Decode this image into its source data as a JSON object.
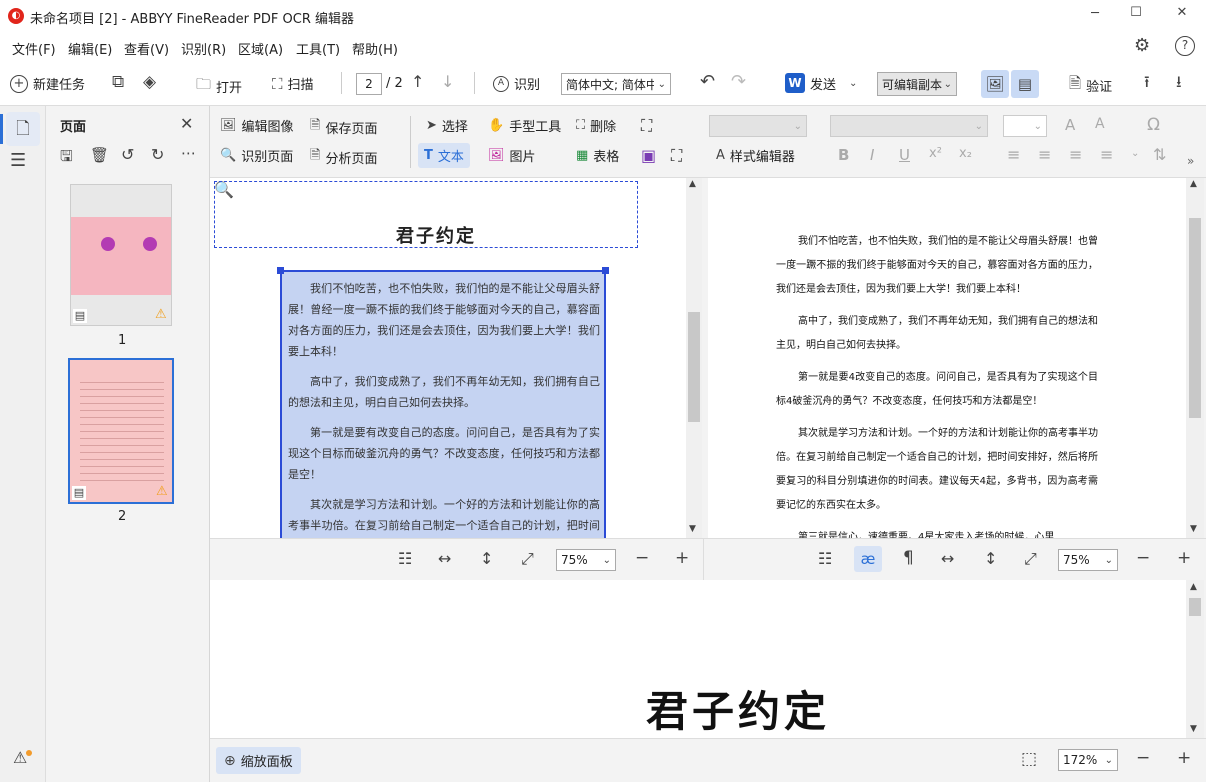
{
  "window": {
    "title": "未命名项目 [2] - ABBYY FineReader PDF OCR 编辑器",
    "minimize": "─",
    "maximize": "☐",
    "close": "✕"
  },
  "menu": [
    "文件(F)",
    "编辑(E)",
    "查看(V)",
    "识别(R)",
    "区域(A)",
    "工具(T)",
    "帮助(H)"
  ],
  "toolbar": {
    "new_task": "新建任务",
    "open": "打开",
    "scan": "扫描",
    "page_num": "2",
    "page_total": "/ 2",
    "recognize": "识别",
    "language": "简体中文; 简体中",
    "send": "发送",
    "edit_mode": "可编辑副本",
    "verify": "验证"
  },
  "pages_panel": {
    "title": "页面",
    "thumbs": [
      {
        "label": "1"
      },
      {
        "label": "2"
      }
    ]
  },
  "image_tools": {
    "edit_image": "编辑图像",
    "save_page": "保存页面",
    "recognize_page": "识别页面",
    "analyze_page": "分析页面",
    "select": "选择",
    "hand": "手型工具",
    "delete": "删除",
    "text": "文本",
    "picture": "图片",
    "table": "表格"
  },
  "text_tools": {
    "style_editor": "样式编辑器"
  },
  "source_doc": {
    "title": "君子约定",
    "paragraphs": [
      "我们不怕吃苦，也不怕失败，我们怕的是不能让父母眉头舒展！曾经一度一蹶不振的我们终于能够面对今天的自己，慕容面对各方面的压力，我们还是会去顶住，因为我们要上大学！我们要上本科！",
      "高中了，我们变成熟了，我们不再年幼无知，我们拥有自己的想法和主见，明白自己如何去抉择。",
      "第一就是要有改变自己的态度。问问自己，是否具有为了实现这个目标而破釜沉舟的勇气？不改变态度，任何技巧和方法都是空！",
      "其次就是学习方法和计划。一个好的方法和计划能让你的高考事半功倍。在复习前给自己制定一个适合自己的计划，把时间安排好，然后将所要复习的科目分别填进你的时间表。建议每天早起，多背书，因为高考需要记忆的东西实在太多。"
    ]
  },
  "ocr_text": {
    "paragraphs": [
      "我们不怕吃苦，也不怕失败，我们怕的是不能让父母眉头舒展！也曾一度一蹶不振的我们终于能够面对今天的自己，慕容面对各方面的压力，我们还是会去顶住，因为我们要上大学！我们要上本科！",
      "高中了，我们变成熟了，我们不再年幼无知，我们拥有自己的想法和主见，明白自己如何去抉择。",
      "第一就是要4改变自己的态度。问问自己，是否具有为了实现这个目标4破釜沉舟的勇气？不改变态度，任何技巧和方法都是空！",
      "其次就是学习方法和计划。一个好的方法和计划能让你的高考事半功倍。在复习前给自己制定一个适合自己的计划，把时间安排好，然后将所要复习的科目分别填进你的时间表。建议每天4起，多背书，因为高考需要记忆的东西实在太多。",
      "第三就是信心，速德重要。4星大家走入考场的时候，心里"
    ]
  },
  "bottom": {
    "zoom_image": "75%",
    "zoom_text": "75%",
    "zoom_panel_btn": "缩放面板",
    "zoom_panel": "172%",
    "zoom_title": "君子约定"
  },
  "colors": {
    "accent": "#2b6fd6",
    "highlight": "#aeeeee",
    "selection": "#c5d3f2",
    "thumb_bg": "#f7c6c6"
  }
}
